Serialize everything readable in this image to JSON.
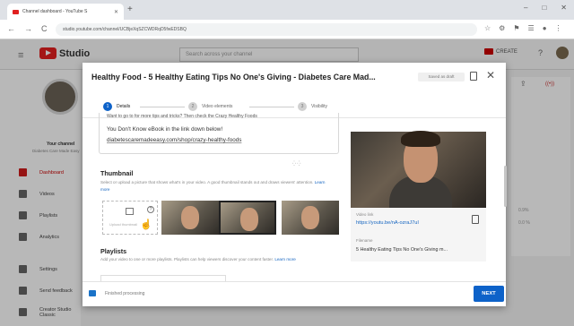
{
  "browser": {
    "tab_title": "Channel dashboard - YouTube S",
    "new_tab": "+",
    "window_controls": [
      "–",
      "□",
      "✕"
    ],
    "url": "studio.youtube.com/channel/UCBjeXqSZCWDRqD5fwEDSBQ",
    "nav_buttons": [
      "←",
      "→",
      "C",
      "⌂"
    ],
    "extension_icons": [
      "☆",
      "⚙",
      "⚑",
      "☰",
      "●",
      "⋮"
    ]
  },
  "studio": {
    "logo_text": "Studio",
    "menu_icon": "≡",
    "search_placeholder": "Search across your channel",
    "create_label": "CREATE",
    "help_icon": "?",
    "channel_name": "Your channel",
    "channel_sub": "Diabetes Care Made Easy",
    "sidebar": [
      {
        "label": "Dashboard",
        "active": true
      },
      {
        "label": "Videos",
        "active": false
      },
      {
        "label": "Playlists",
        "active": false
      },
      {
        "label": "Analytics",
        "active": false
      },
      {
        "label": "Settings",
        "active": false
      },
      {
        "label": "Send feedback",
        "active": false
      },
      {
        "label": "Creator Studio Classic",
        "active": false
      }
    ],
    "right_card": {
      "upload": "⇪",
      "live": "((•))",
      "a": "0.9%",
      "b": "0.0 %"
    }
  },
  "modal": {
    "title": "Healthy Food - 5 Healthy Eating Tips No One's Giving - Diabetes Care Mad...",
    "draft_badge": "Saved as draft",
    "close_icon": "✕",
    "steps": [
      {
        "num": "1",
        "label": "Details",
        "active": true
      },
      {
        "num": "2",
        "label": "Video elements",
        "active": false
      },
      {
        "num": "3",
        "label": "Visibility",
        "active": false
      }
    ],
    "description": {
      "line1": "Want to go to for more tips and tricks? Then check the Crazy Healthy Foods",
      "line2": "You Don't Know eBook in the link down below!",
      "line3": "diabetescaremadeeasy.com/shop/crazy-healthy-foods",
      "resize": "⁛ ⁛"
    },
    "thumbnail": {
      "heading": "Thumbnail",
      "help": "Select or upload a picture that shows what's in your video. A good thumbnail stands out and draws viewers' attention.",
      "learn_more": "Learn more",
      "upload_label": "Upload thumbnail",
      "help_icon": "?"
    },
    "playlists": {
      "heading": "Playlists",
      "help": "Add your video to one or more playlists. Playlists can help viewers discover your content faster.",
      "learn_more": "Learn more"
    },
    "video_info": {
      "link_label": "Video link",
      "link": "https://youtu.be/nA-ozraJ7uI",
      "filename_label": "Filename",
      "filename": "5 Healthy Eating Tips No One's Giving m..."
    },
    "footer": {
      "status": "Finished processing",
      "next": "NEXT"
    }
  },
  "colors": {
    "accent": "#0d62c9",
    "brand_red": "#e41f1f",
    "link": "#1565c0"
  }
}
